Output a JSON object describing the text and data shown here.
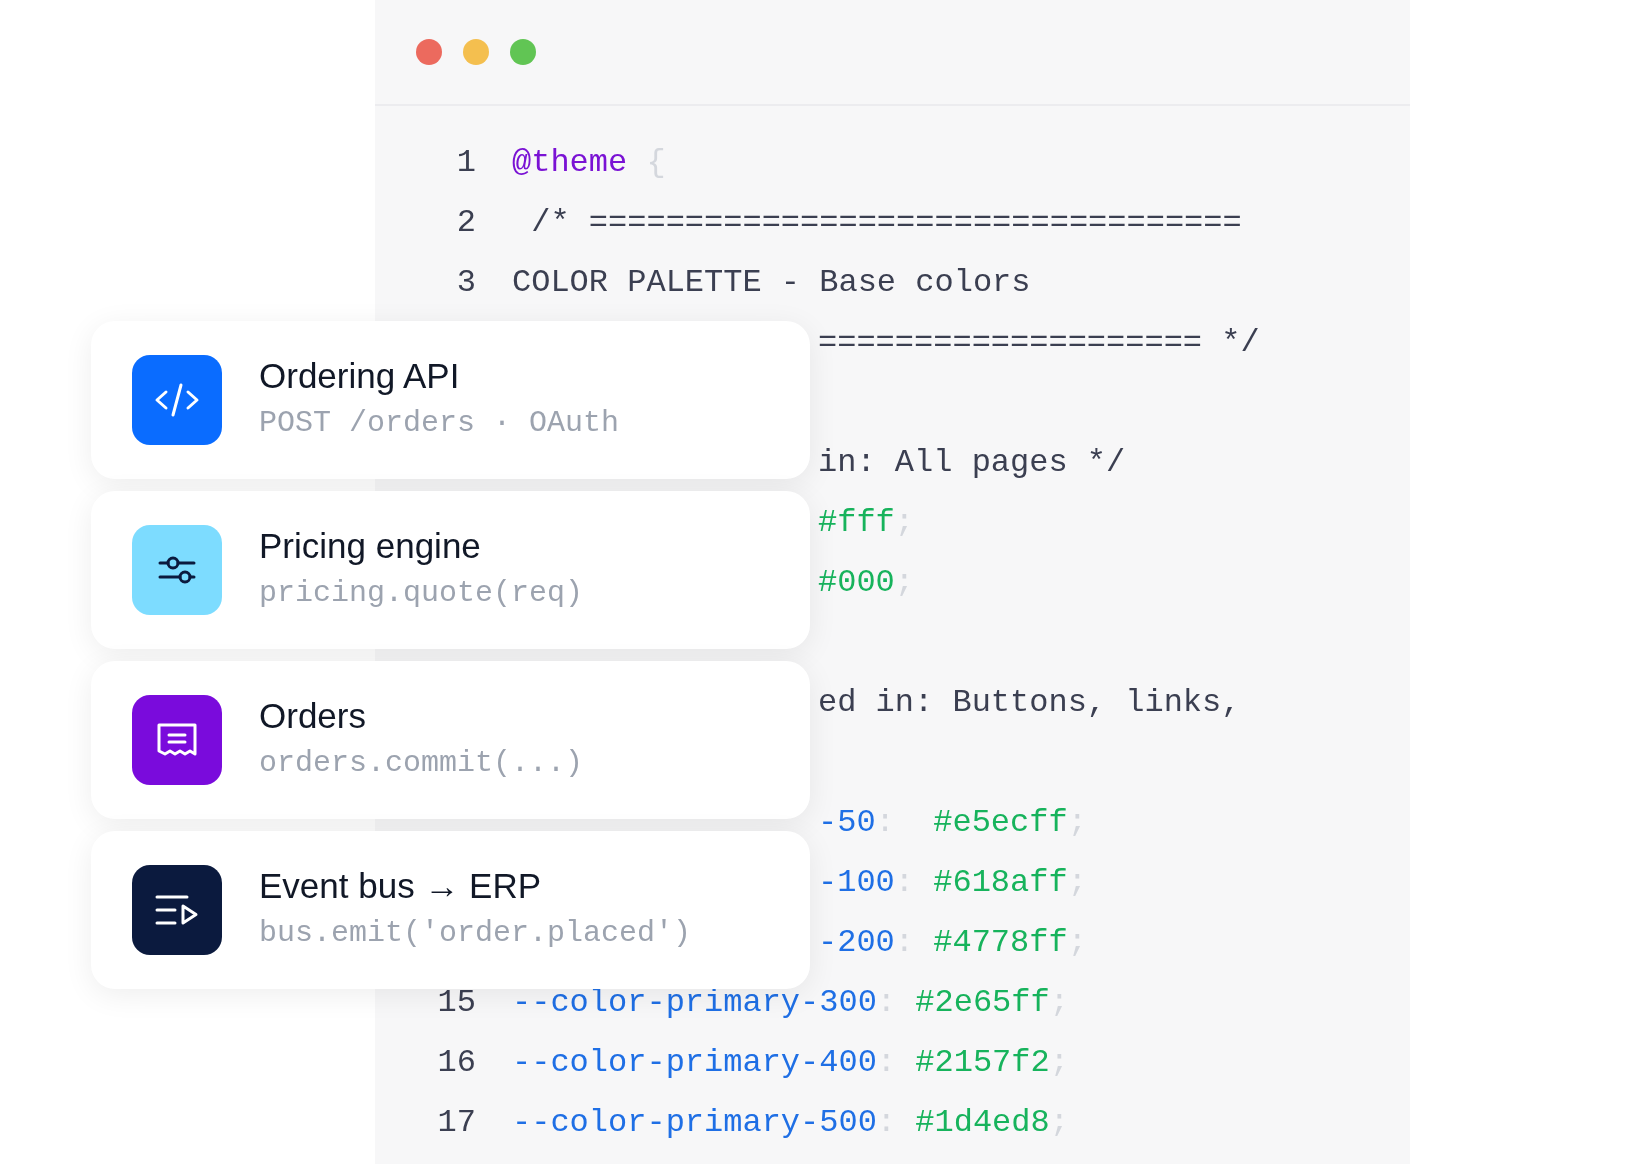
{
  "window": {
    "controls": [
      {
        "color": "#ec6a5e"
      },
      {
        "color": "#f4bf4f"
      },
      {
        "color": "#61c554"
      }
    ]
  },
  "editor": {
    "lines": [
      {
        "kind": "full",
        "number": "1",
        "tokens": [
          {
            "kind": "keyword",
            "text": "@theme"
          },
          {
            "kind": "punct",
            "text": " {"
          }
        ]
      },
      {
        "kind": "full",
        "number": "2",
        "tokens": [
          {
            "kind": "plain",
            "text": " /* =================================="
          }
        ]
      },
      {
        "kind": "full",
        "number": "3",
        "tokens": [
          {
            "kind": "plain",
            "text": "COLOR PALETTE - Base colors"
          }
        ]
      },
      {
        "kind": "partial",
        "tokens": [
          {
            "kind": "plain",
            "text": "==================== */"
          }
        ]
      },
      {
        "kind": "hidden"
      },
      {
        "kind": "partial",
        "tokens": [
          {
            "kind": "plain",
            "text": "in: All pages */"
          }
        ]
      },
      {
        "kind": "partial",
        "tokens": [
          {
            "kind": "value",
            "text": "#fff"
          },
          {
            "kind": "punct",
            "text": ";"
          }
        ]
      },
      {
        "kind": "partial",
        "tokens": [
          {
            "kind": "value",
            "text": "#000"
          },
          {
            "kind": "punct",
            "text": ";"
          }
        ]
      },
      {
        "kind": "hidden"
      },
      {
        "kind": "partial",
        "tokens": [
          {
            "kind": "plain",
            "text": "ed in: Buttons, links,"
          }
        ]
      },
      {
        "kind": "hidden"
      },
      {
        "kind": "partial",
        "tokens": [
          {
            "kind": "property",
            "text": "-50"
          },
          {
            "kind": "punct",
            "text": ":  "
          },
          {
            "kind": "value",
            "text": "#e5ecff"
          },
          {
            "kind": "punct",
            "text": ";"
          }
        ]
      },
      {
        "kind": "partial",
        "tokens": [
          {
            "kind": "property",
            "text": "-100"
          },
          {
            "kind": "punct",
            "text": ": "
          },
          {
            "kind": "value",
            "text": "#618aff"
          },
          {
            "kind": "punct",
            "text": ";"
          }
        ]
      },
      {
        "kind": "partial",
        "tokens": [
          {
            "kind": "property",
            "text": "-200"
          },
          {
            "kind": "punct",
            "text": ": "
          },
          {
            "kind": "value",
            "text": "#4778ff"
          },
          {
            "kind": "punct",
            "text": ";"
          }
        ]
      },
      {
        "kind": "full",
        "number": "15",
        "tokens": [
          {
            "kind": "property",
            "text": "--color-primary-300"
          },
          {
            "kind": "punct",
            "text": ": "
          },
          {
            "kind": "value",
            "text": "#2e65ff"
          },
          {
            "kind": "punct",
            "text": ";"
          }
        ]
      },
      {
        "kind": "full",
        "number": "16",
        "tokens": [
          {
            "kind": "property",
            "text": "--color-primary-400"
          },
          {
            "kind": "punct",
            "text": ": "
          },
          {
            "kind": "value",
            "text": "#2157f2"
          },
          {
            "kind": "punct",
            "text": ";"
          }
        ]
      },
      {
        "kind": "full",
        "number": "17",
        "tokens": [
          {
            "kind": "property",
            "text": "--color-primary-500"
          },
          {
            "kind": "punct",
            "text": ": "
          },
          {
            "kind": "value",
            "text": "#1d4ed8"
          },
          {
            "kind": "punct",
            "text": ";"
          }
        ]
      }
    ]
  },
  "cards": [
    {
      "kind": "code",
      "color": "#0a6cff",
      "title": "Ordering API",
      "subtitle": "POST /orders · OAuth"
    },
    {
      "kind": "sliders",
      "color": "#7ddcff",
      "title": "Pricing engine",
      "subtitle": "pricing.quote(req)"
    },
    {
      "kind": "receipt",
      "color": "#7a0bdc",
      "title": "Orders",
      "subtitle": "orders.commit(...)"
    },
    {
      "kind": "list-play",
      "color": "#0b1a3e",
      "title": "Event bus → ERP",
      "subtitle": "bus.emit('order.placed')"
    }
  ]
}
